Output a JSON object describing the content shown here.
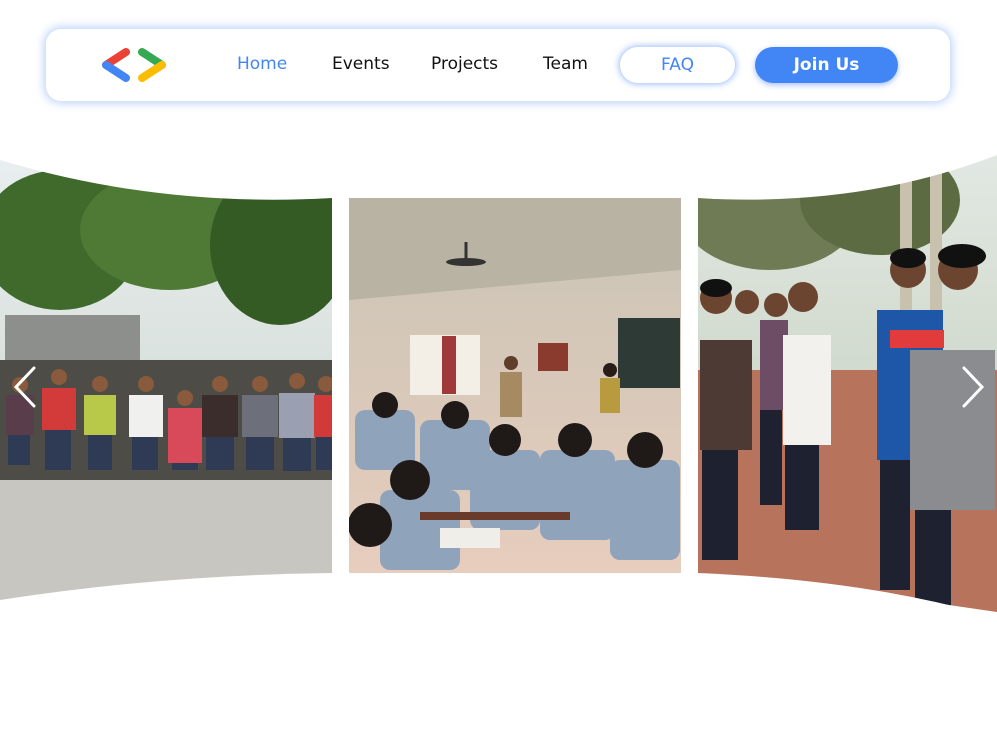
{
  "navbar": {
    "logo_icon": "gdsc-brackets-logo-icon",
    "links": [
      {
        "label": "Home",
        "active": true
      },
      {
        "label": "Events",
        "active": false
      },
      {
        "label": "Projects",
        "active": false
      },
      {
        "label": "Team",
        "active": false
      }
    ],
    "faq_label": "FAQ",
    "join_label": "Join Us"
  },
  "carousel": {
    "slides": [
      {
        "name": "group-photo-outdoor",
        "description_icon": "photo-image"
      },
      {
        "name": "classroom-session-photo",
        "description_icon": "photo-image"
      },
      {
        "name": "students-outdoor-event-photo",
        "description_icon": "photo-image"
      }
    ],
    "prev_icon": "chevron-left-icon",
    "next_icon": "chevron-right-icon"
  },
  "colors": {
    "brand_blue": "#4285f4",
    "brand_red": "#ea4335",
    "brand_green": "#34a853",
    "brand_yellow": "#fbbc04"
  }
}
